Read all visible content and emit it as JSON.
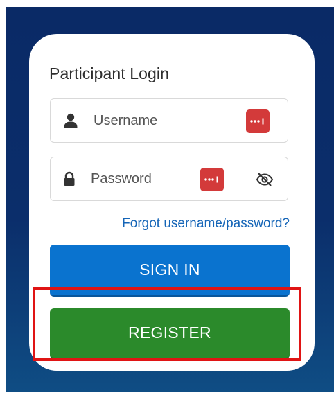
{
  "login": {
    "title": "Participant Login",
    "username": {
      "placeholder": "Username",
      "value": "",
      "icon": "user-icon",
      "password_manager_icon": "password-manager-icon"
    },
    "password": {
      "placeholder": "Password",
      "value": "",
      "icon": "lock-icon",
      "password_manager_icon": "password-manager-icon",
      "toggle_icon": "eye-slash-icon"
    },
    "forgot_link": "Forgot username/password?",
    "signin_label": "SIGN IN",
    "register_label": "REGISTER"
  },
  "colors": {
    "background_top": "#0a2a66",
    "background_bottom": "#0f4d84",
    "signin": "#0a73cf",
    "register": "#2b8a2b",
    "link": "#1565b7",
    "highlight": "#e01414",
    "password_manager_badge": "#d33a3a"
  }
}
